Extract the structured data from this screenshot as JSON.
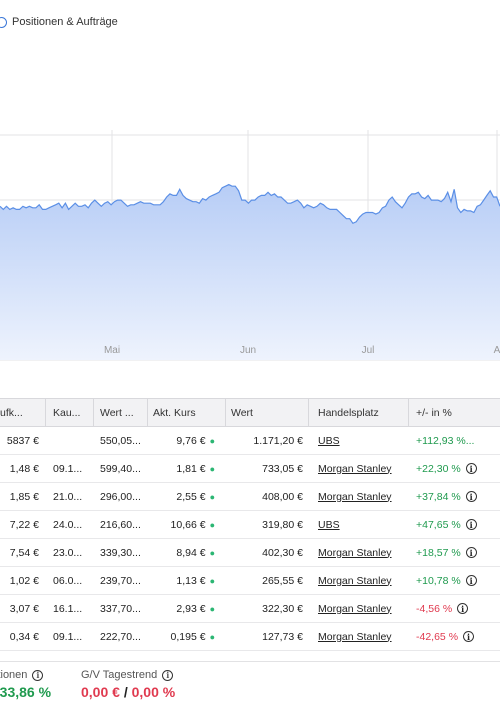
{
  "toggle": {
    "label": "Positionen & Aufträge"
  },
  "chart_data": {
    "type": "area",
    "x_labels": [
      "Mai",
      "Jun",
      "Jul",
      "A"
    ],
    "values": [
      14,
      12,
      14,
      12,
      13,
      12,
      12,
      14,
      13,
      14,
      13,
      13,
      15,
      12,
      12,
      13,
      14,
      15,
      16,
      13,
      16,
      12,
      14,
      16,
      14,
      14,
      15,
      13,
      16,
      18,
      16,
      14,
      16,
      17,
      15,
      17,
      18,
      18,
      16,
      14,
      15,
      15,
      16,
      17,
      16,
      16,
      16,
      15,
      15,
      15,
      17,
      20,
      22,
      21,
      21,
      25,
      21,
      19,
      18,
      17,
      17,
      16,
      19,
      18,
      20,
      21,
      22,
      23,
      26,
      27,
      28,
      27,
      27,
      24,
      18,
      18,
      16,
      18,
      18,
      20,
      21,
      21,
      23,
      21,
      22,
      20,
      20,
      18,
      16,
      16,
      17,
      18,
      16,
      13,
      15,
      14,
      13,
      14,
      16,
      15,
      13,
      12,
      12,
      12,
      10,
      8,
      6,
      6,
      3,
      4,
      7,
      9,
      10,
      10,
      10,
      9,
      10,
      13,
      14,
      18,
      20,
      17,
      15,
      13,
      16,
      20,
      22,
      22,
      23,
      20,
      19,
      21,
      18,
      18,
      18,
      17,
      19,
      23,
      17,
      25,
      13,
      10,
      12,
      11,
      11,
      10,
      14,
      15,
      18,
      21,
      24,
      20,
      20,
      14
    ],
    "fill_top": "#b7cdf6",
    "fill_bottom": "#eef3fd",
    "line_color": "#5b8fe6"
  },
  "table": {
    "headers": [
      "ufk...",
      "Kau...",
      "Wert ...",
      "Akt. Kurs",
      "Wert",
      "Handelsplatz",
      "+/- in %"
    ],
    "rows": [
      {
        "c0": "5837 €",
        "c1": "",
        "c2": "550,05...",
        "c3": "9,76 €",
        "c4": "1.171,20 €",
        "c5": "UBS",
        "c6": "+112,93 %...",
        "pct_sign": "pos"
      },
      {
        "c0": "1,48 €",
        "c1": "09.1...",
        "c2": "599,40...",
        "c3": "1,81 €",
        "c4": "733,05 €",
        "c5": "Morgan Stanley",
        "c6": "+22,30 %",
        "pct_sign": "pos"
      },
      {
        "c0": "1,85 €",
        "c1": "21.0...",
        "c2": "296,00...",
        "c3": "2,55 €",
        "c4": "408,00 €",
        "c5": "Morgan Stanley",
        "c6": "+37,84 %",
        "pct_sign": "pos"
      },
      {
        "c0": "7,22 €",
        "c1": "24.0...",
        "c2": "216,60...",
        "c3": "10,66 €",
        "c4": "319,80 €",
        "c5": "UBS",
        "c6": "+47,65 %",
        "pct_sign": "pos"
      },
      {
        "c0": "7,54 €",
        "c1": "23.0...",
        "c2": "339,30...",
        "c3": "8,94 €",
        "c4": "402,30 €",
        "c5": "Morgan Stanley",
        "c6": "+18,57 %",
        "pct_sign": "pos"
      },
      {
        "c0": "1,02 €",
        "c1": "06.0...",
        "c2": "239,70...",
        "c3": "1,13 €",
        "c4": "265,55 €",
        "c5": "Morgan Stanley",
        "c6": "+10,78 %",
        "pct_sign": "pos"
      },
      {
        "c0": "3,07 €",
        "c1": "16.1...",
        "c2": "337,70...",
        "c3": "2,93 €",
        "c4": "322,30 €",
        "c5": "Morgan Stanley",
        "c6": "-4,56 %",
        "pct_sign": "neg"
      },
      {
        "c0": "0,34 €",
        "c1": "09.1...",
        "c2": "222,70...",
        "c3": "0,195 €",
        "c4": "127,73 €",
        "c5": "Morgan Stanley",
        "c6": "-42,65 %",
        "pct_sign": "neg"
      }
    ]
  },
  "summary": {
    "positions_label": "itionen",
    "positions_value": "-33,86 %",
    "trend_label": "G/V Tagestrend",
    "trend_value_eur": "0,00 €",
    "trend_sep": "/",
    "trend_value_pct": "0,00 %"
  }
}
